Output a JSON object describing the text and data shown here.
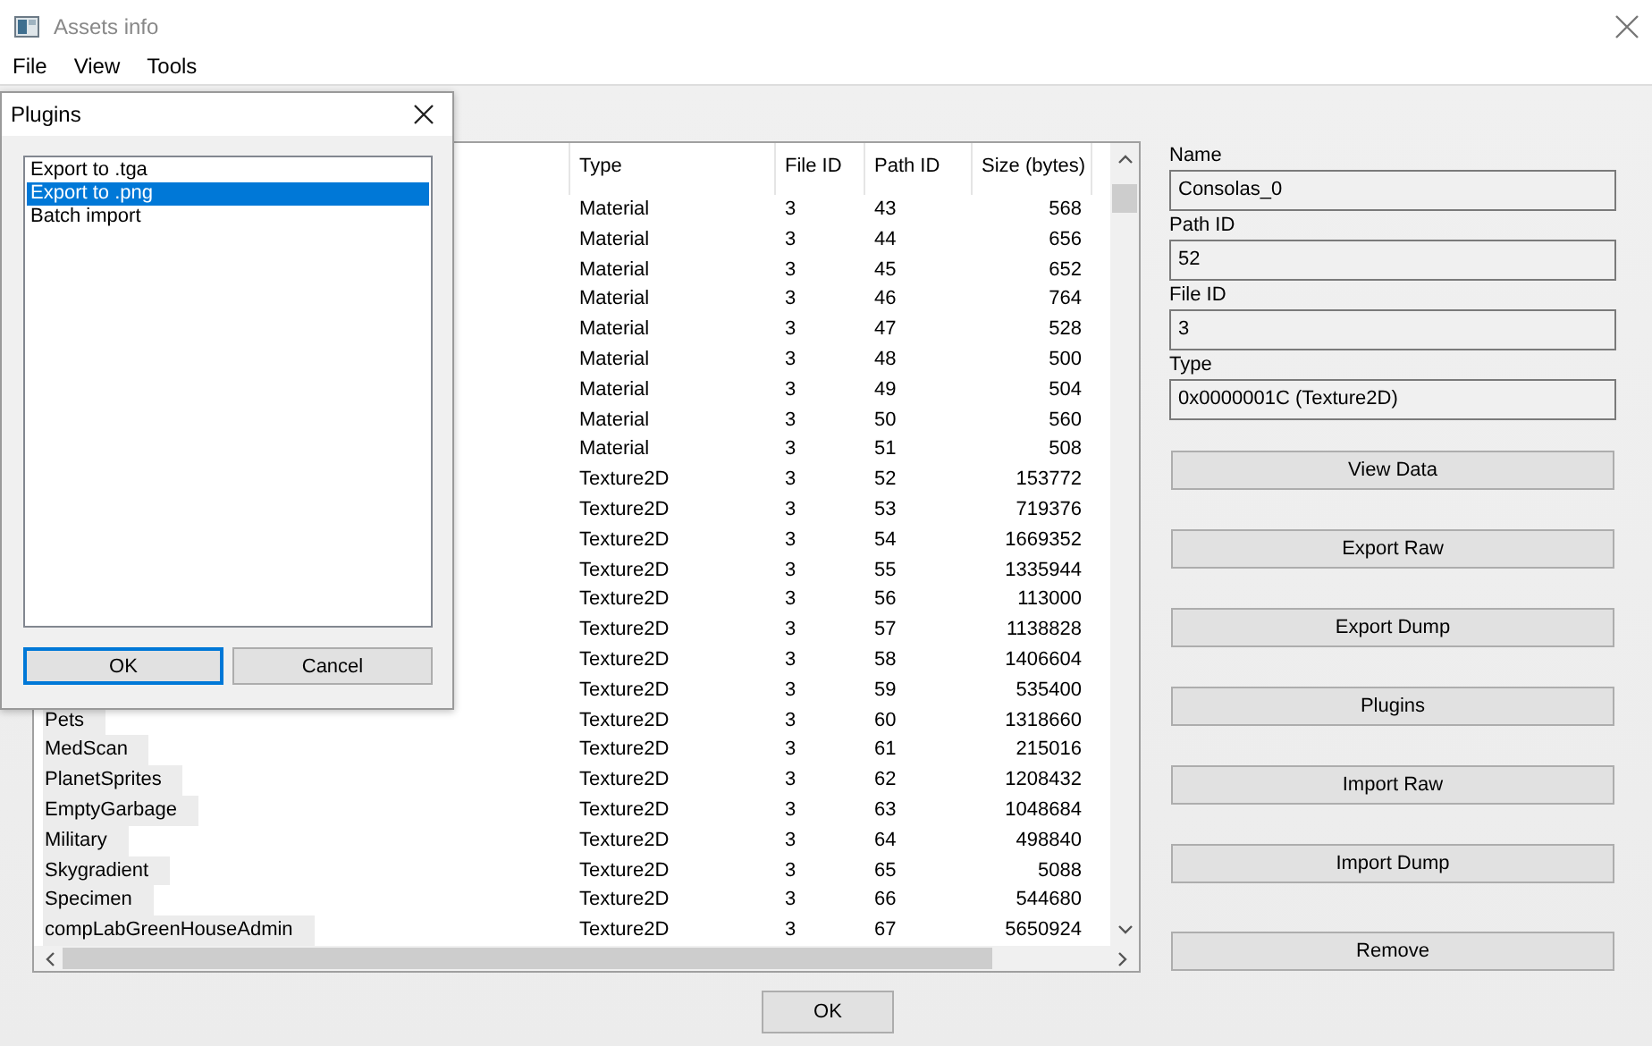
{
  "window": {
    "title": "Assets info"
  },
  "menu": [
    "File",
    "View",
    "Tools"
  ],
  "table": {
    "columns": [
      "Type",
      "File ID",
      "Path ID",
      "Size (bytes)"
    ],
    "rows": [
      {
        "type": "Material",
        "file_id": "3",
        "path_id": "43",
        "size": "568"
      },
      {
        "type": "Material",
        "file_id": "3",
        "path_id": "44",
        "size": "656"
      },
      {
        "type": "Material",
        "file_id": "3",
        "path_id": "45",
        "size": "652"
      },
      {
        "type": "Material",
        "file_id": "3",
        "path_id": "46",
        "size": "764"
      },
      {
        "type": "Material",
        "file_id": "3",
        "path_id": "47",
        "size": "528"
      },
      {
        "type": "Material",
        "file_id": "3",
        "path_id": "48",
        "size": "500"
      },
      {
        "type": "Material",
        "file_id": "3",
        "path_id": "49",
        "size": "504"
      },
      {
        "type": "Material",
        "file_id": "3",
        "path_id": "50",
        "size": "560"
      },
      {
        "type": "Material",
        "file_id": "3",
        "path_id": "51",
        "size": "508"
      },
      {
        "type": "Texture2D",
        "file_id": "3",
        "path_id": "52",
        "size": "153772"
      },
      {
        "type": "Texture2D",
        "file_id": "3",
        "path_id": "53",
        "size": "719376"
      },
      {
        "type": "Texture2D",
        "file_id": "3",
        "path_id": "54",
        "size": "1669352"
      },
      {
        "type": "Texture2D",
        "file_id": "3",
        "path_id": "55",
        "size": "1335944"
      },
      {
        "type": "Texture2D",
        "file_id": "3",
        "path_id": "56",
        "size": "113000"
      },
      {
        "type": "Texture2D",
        "file_id": "3",
        "path_id": "57",
        "size": "1138828"
      },
      {
        "type": "Texture2D",
        "file_id": "3",
        "path_id": "58",
        "size": "1406604"
      },
      {
        "type": "Texture2D",
        "file_id": "3",
        "path_id": "59",
        "size": "535400"
      },
      {
        "name": "Pets",
        "type": "Texture2D",
        "file_id": "3",
        "path_id": "60",
        "size": "1318660"
      },
      {
        "name": "MedScan",
        "type": "Texture2D",
        "file_id": "3",
        "path_id": "61",
        "size": "215016"
      },
      {
        "name": "PlanetSprites",
        "type": "Texture2D",
        "file_id": "3",
        "path_id": "62",
        "size": "1208432"
      },
      {
        "name": "EmptyGarbage",
        "type": "Texture2D",
        "file_id": "3",
        "path_id": "63",
        "size": "1048684"
      },
      {
        "name": "Military",
        "type": "Texture2D",
        "file_id": "3",
        "path_id": "64",
        "size": "498840"
      },
      {
        "name": "Skygradient",
        "type": "Texture2D",
        "file_id": "3",
        "path_id": "65",
        "size": "5088"
      },
      {
        "name": "Specimen",
        "type": "Texture2D",
        "file_id": "3",
        "path_id": "66",
        "size": "544680"
      },
      {
        "name": "compLabGreenHouseAdmin",
        "type": "Texture2D",
        "file_id": "3",
        "path_id": "67",
        "size": "5650924"
      }
    ]
  },
  "details": [
    {
      "label": "Name",
      "value": "Consolas_0"
    },
    {
      "label": "Path ID",
      "value": "52"
    },
    {
      "label": "File ID",
      "value": "3"
    },
    {
      "label": "Type",
      "value": "0x0000001C (Texture2D)"
    }
  ],
  "actions": [
    "View Data",
    "Export Raw",
    "Export Dump",
    "Plugins",
    "Import Raw",
    "Import Dump",
    "Remove"
  ],
  "ok_button": "OK",
  "dialog": {
    "title": "Plugins",
    "items": [
      {
        "label": "Export to .tga",
        "selected": false
      },
      {
        "label": "Export to .png",
        "selected": true
      },
      {
        "label": "Batch import",
        "selected": false
      }
    ],
    "buttons": [
      "OK",
      "Cancel"
    ]
  }
}
